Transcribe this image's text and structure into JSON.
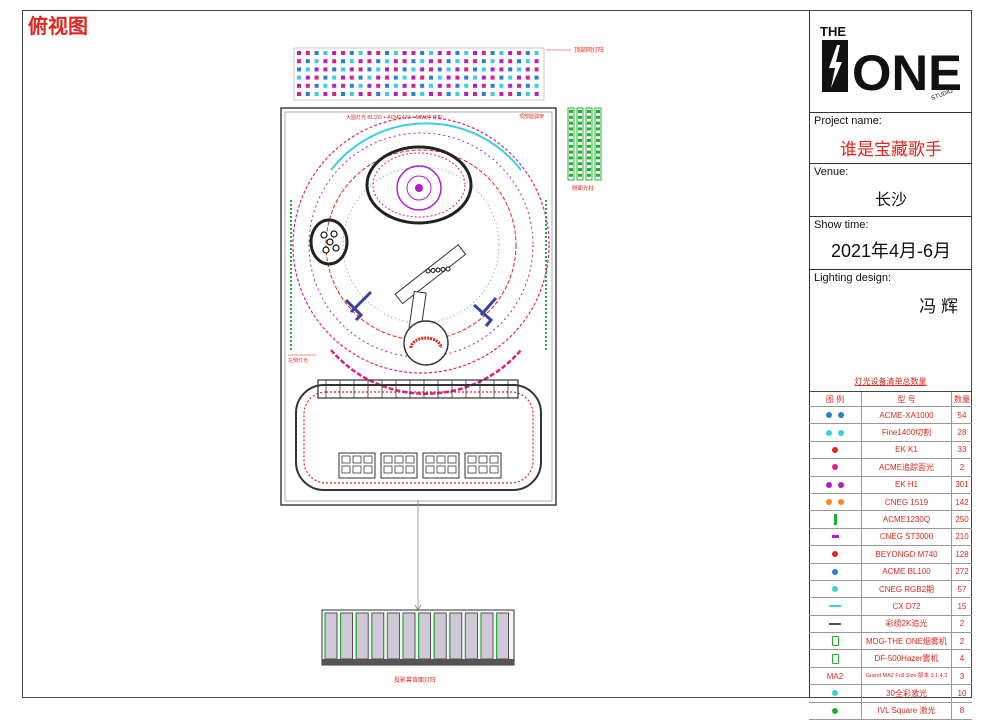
{
  "view_title": "俯视图",
  "drawing": {
    "top_truss_label": "顶部网灯阵",
    "stage_header_label": "大圆灯光 BL100 + ACME470 + 50W灯 环形",
    "arc_truss_label": "顶部圆弧架",
    "side_column_label": "侧面光柱",
    "left_wing_label": "左侧灯光",
    "bottom_screen_label": "投影幕背面灯阵"
  },
  "title_block": {
    "logo_the": "THE",
    "logo_one": "ONE",
    "logo_studio": "STUDIO",
    "project_label": "Project name:",
    "project_value": "谁是宝藏歌手",
    "venue_label": "Venue:",
    "venue_value": "长沙",
    "show_label": "Show time:",
    "show_value": "2021年4月-6月",
    "lighting_label": "Lighting design:",
    "lighting_value": "冯 辉"
  },
  "legend": {
    "title": "灯光设备清单总数量",
    "headers": {
      "symbol": "图 例",
      "model": "型 号",
      "qty": "数量"
    },
    "rows": [
      {
        "model": "ACME-XA1000",
        "qty": "54",
        "symbol": "dot-pair",
        "color": "#2a7fd4"
      },
      {
        "model": "Fine1400切割",
        "qty": "28",
        "symbol": "dot-pair",
        "color": "#3ad0e0"
      },
      {
        "model": "EK K1",
        "qty": "33",
        "symbol": "dot",
        "color": "#e0271e"
      },
      {
        "model": "ACME追踪面光",
        "qty": "2",
        "symbol": "dot",
        "color": "#e02080"
      },
      {
        "model": "EK H1",
        "qty": "301",
        "symbol": "dot-pair",
        "color": "#b020c8"
      },
      {
        "model": "CNEG 1519",
        "qty": "142",
        "symbol": "dot-pair",
        "color": "#f08a20"
      },
      {
        "model": "ACME1230Q",
        "qty": "250",
        "symbol": "bar",
        "color": "#20b030"
      },
      {
        "model": "CNEG ST3000",
        "qty": "210",
        "symbol": "dash",
        "color": "#b020c8"
      },
      {
        "model": "BEYONGD M740",
        "qty": "128",
        "symbol": "dot",
        "color": "#e0271e"
      },
      {
        "model": "ACME BL100",
        "qty": "272",
        "symbol": "dot",
        "color": "#2a7fd4"
      },
      {
        "model": "CNEG RGB2期",
        "qty": "57",
        "symbol": "dot",
        "color": "#3ad0e0"
      },
      {
        "model": "CX D72",
        "qty": "15",
        "symbol": "line",
        "color": "#3ad0e0"
      },
      {
        "model": "彩缆2K追光",
        "qty": "2",
        "symbol": "line",
        "color": "#555555"
      },
      {
        "model": "MDG-THE ONE烟雾机",
        "qty": "2",
        "symbol": "box",
        "color": "#20b030"
      },
      {
        "model": "DF-500Hazer雾机",
        "qty": "4",
        "symbol": "box",
        "color": "#20b030"
      },
      {
        "model": "Grand MA2 Full Size 版本 3.1.4.3",
        "qty": "3",
        "symbol": "text",
        "symbol_text": "MA2",
        "color": "#e0271e",
        "small": true
      },
      {
        "model": "30全彩激光",
        "qty": "10",
        "symbol": "dot",
        "color": "#3ad0e0"
      },
      {
        "model": "IVL Square 激光",
        "qty": "8",
        "symbol": "dot",
        "color": "#20b030"
      }
    ]
  }
}
